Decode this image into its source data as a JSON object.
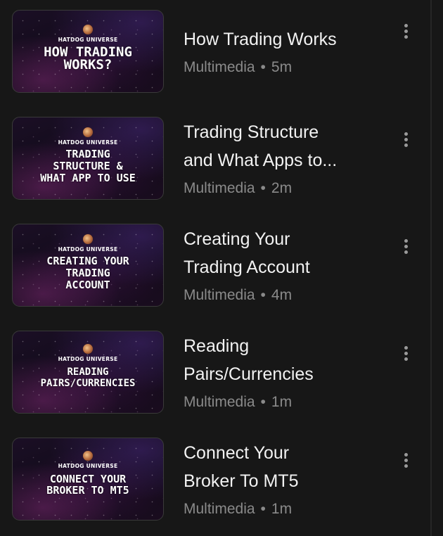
{
  "thumbnail_brand": "HATDOG UNIVERSE",
  "items": [
    {
      "thumb_text": "HOW TRADING\nWORKS?",
      "title_lines": [
        "How Trading Works"
      ],
      "type": "Multimedia",
      "separator": "•",
      "duration": "5m",
      "more_icon": "vertical-ellipsis-icon"
    },
    {
      "thumb_text": "TRADING\nSTRUCTURE &\nWHAT APP TO USE",
      "title_lines": [
        "Trading Structure",
        "and What Apps to..."
      ],
      "type": "Multimedia",
      "separator": "•",
      "duration": "2m",
      "more_icon": "vertical-ellipsis-icon"
    },
    {
      "thumb_text": "CREATING YOUR\nTRADING\nACCOUNT",
      "title_lines": [
        "Creating Your",
        "Trading Account"
      ],
      "type": "Multimedia",
      "separator": "•",
      "duration": "4m",
      "more_icon": "vertical-ellipsis-icon"
    },
    {
      "thumb_text": "READING\nPAIRS/CURRENCIES",
      "title_lines": [
        "Reading",
        "Pairs/Currencies"
      ],
      "type": "Multimedia",
      "separator": "•",
      "duration": "1m",
      "more_icon": "vertical-ellipsis-icon"
    },
    {
      "thumb_text": "CONNECT YOUR\nBROKER TO MT5",
      "title_lines": [
        "Connect Your",
        "Broker To MT5"
      ],
      "type": "Multimedia",
      "separator": "•",
      "duration": "1m",
      "more_icon": "vertical-ellipsis-icon"
    }
  ],
  "colors": {
    "background": "#171717",
    "title_text": "#f2f2f2",
    "meta_text": "#8a8a8a",
    "more_icon": "#9a9a9a"
  }
}
